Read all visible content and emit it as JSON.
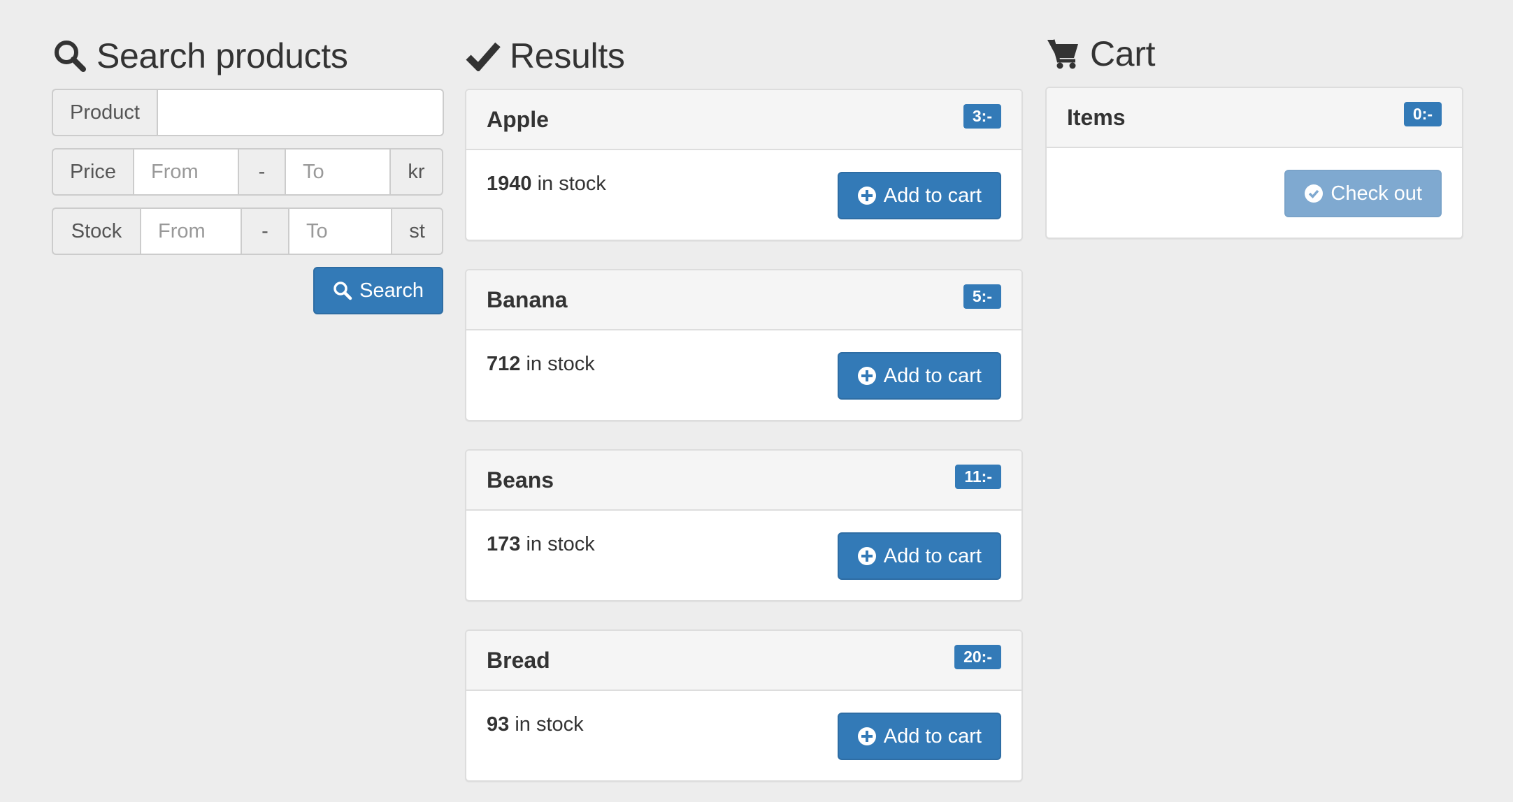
{
  "search": {
    "title": "Search products",
    "product_label": "Product",
    "product_value": "",
    "price_label": "Price",
    "price_from_placeholder": "From",
    "price_separator": "-",
    "price_to_placeholder": "To",
    "price_unit": "kr",
    "stock_label": "Stock",
    "stock_from_placeholder": "From",
    "stock_separator": "-",
    "stock_to_placeholder": "To",
    "stock_unit": "st",
    "button_label": "Search"
  },
  "results": {
    "title": "Results",
    "add_label": "Add to cart",
    "stock_suffix": "in stock",
    "items": [
      {
        "name": "Apple",
        "price": "3:-",
        "stock": "1940"
      },
      {
        "name": "Banana",
        "price": "5:-",
        "stock": "712"
      },
      {
        "name": "Beans",
        "price": "11:-",
        "stock": "173"
      },
      {
        "name": "Bread",
        "price": "20:-",
        "stock": "93"
      }
    ]
  },
  "cart": {
    "title": "Cart",
    "items_label": "Items",
    "total": "0:-",
    "checkout_label": "Check out"
  },
  "colors": {
    "primary": "#337ab7",
    "primary_disabled": "#7fa9d0",
    "background": "#ededed"
  }
}
